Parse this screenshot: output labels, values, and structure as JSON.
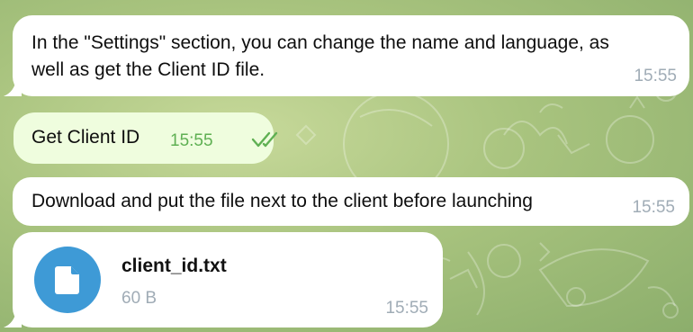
{
  "messages": [
    {
      "direction": "incoming",
      "text_line1": "In the \"Settings\" section, you can change the name and language, as",
      "text_line2": "well as get the Client ID file.",
      "time": "15:55"
    },
    {
      "direction": "outgoing",
      "text": "Get Client ID",
      "time": "15:55",
      "status_icon": "double-check-icon"
    },
    {
      "direction": "incoming",
      "text": "Download and put the file next to the client before launching",
      "time": "15:55"
    },
    {
      "direction": "incoming",
      "file": {
        "name": "client_id.txt",
        "size": "60 B",
        "icon": "document-icon"
      },
      "time": "15:55"
    }
  ],
  "colors": {
    "incoming_bubble": "#ffffff",
    "outgoing_bubble": "#effdde",
    "outgoing_time": "#5fb053",
    "incoming_time": "#a0acb6",
    "file_icon_bg": "#3e9ad6",
    "chat_background": "#a8c37e"
  }
}
